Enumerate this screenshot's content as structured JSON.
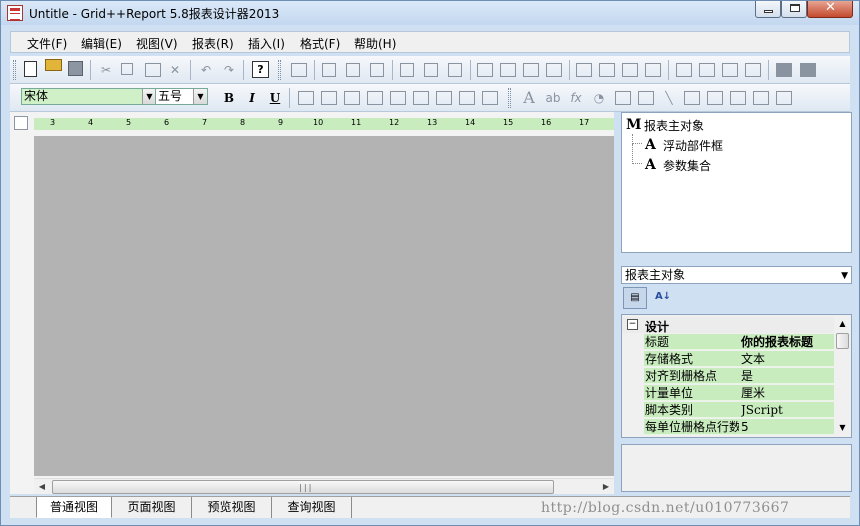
{
  "window": {
    "title": "Untitle - Grid++Report 5.8报表设计器2013",
    "close_glyph": "✕"
  },
  "menu": {
    "items": [
      "文件(F)",
      "编辑(E)",
      "视图(V)",
      "报表(R)",
      "插入(I)",
      "格式(F)",
      "帮助(H)"
    ]
  },
  "toolbar": {
    "help_glyph": "?",
    "font_name": "宋体",
    "font_size": "五号",
    "bold": "B",
    "italic": "I",
    "underline": "U",
    "text_icon": "A",
    "ab_icon": "ab",
    "fx_icon": "fx"
  },
  "ruler": {
    "labels": [
      "3",
      "4",
      "5",
      "6",
      "7",
      "8",
      "9",
      "10",
      "11",
      "12",
      "13",
      "14",
      "15",
      "16",
      "17"
    ]
  },
  "tree": {
    "root": {
      "glyph": "M",
      "label": "报表主对象"
    },
    "children": [
      {
        "glyph": "A",
        "label": "浮动部件框"
      },
      {
        "glyph": "A",
        "label": "参数集合"
      }
    ]
  },
  "object_select": {
    "value": "报表主对象"
  },
  "property_grid": {
    "category": "设计",
    "toggle": "−",
    "rows": [
      {
        "name": "标题",
        "value": "你的报表标题",
        "bold": true
      },
      {
        "name": "存储格式",
        "value": "文本"
      },
      {
        "name": "对齐到栅格点",
        "value": "是"
      },
      {
        "name": "计量单位",
        "value": "厘米"
      },
      {
        "name": "脚本类别",
        "value": "JScript"
      },
      {
        "name": "每单位栅格点行数",
        "value": "5"
      }
    ]
  },
  "tabs": [
    "普通视图",
    "页面视图",
    "预览视图",
    "查询视图"
  ],
  "watermark": "http://blog.csdn.net/u010773667",
  "colors": {
    "frame": "#cfe0f3",
    "canvas": "#b3b3b3",
    "ruler": "#c8ecbe",
    "property_row": "#c8ecbe"
  }
}
